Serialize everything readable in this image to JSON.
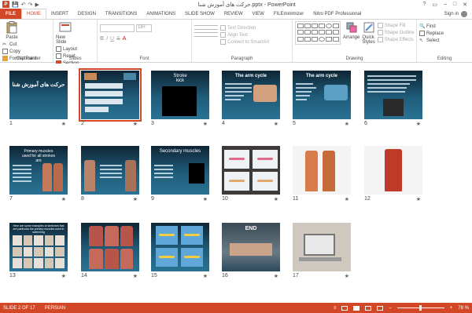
{
  "window": {
    "title": "حرکت های آموزش شنا.pptx - PowerPoint",
    "controls": [
      "?",
      "▭",
      "–",
      "□",
      "✕"
    ]
  },
  "qat": {
    "app_icon": "P",
    "save": "💾",
    "undo": "↶",
    "redo": "↷",
    "start": "▶"
  },
  "tabs": [
    "FILE",
    "HOME",
    "INSERT",
    "DESIGN",
    "TRANSITIONS",
    "ANIMATIONS",
    "SLIDE SHOW",
    "REVIEW",
    "VIEW",
    "FILEminimizer",
    "Nitro PDF Professional"
  ],
  "active_tab": "HOME",
  "signin": "Sign in",
  "ribbon": {
    "clipboard": {
      "paste": "Paste",
      "cut": "Cut",
      "copy": "Copy",
      "format_painter": "Format Painter",
      "label": "Clipboard"
    },
    "slides": {
      "new_slide": "New Slide",
      "layout": "Layout",
      "reset": "Reset",
      "section": "Section",
      "label": "Slides"
    },
    "font": {
      "label": "Font",
      "size": "18+"
    },
    "paragraph": {
      "text_direction": "Text Direction",
      "align_text": "Align Text",
      "convert_smartart": "Convert to SmartArt",
      "label": "Paragraph"
    },
    "drawing": {
      "arrange": "Arrange",
      "quick_styles": "Quick Styles",
      "shape_fill": "Shape Fill",
      "shape_outline": "Shape Outline",
      "shape_effects": "Shape Effects",
      "label": "Drawing"
    },
    "editing": {
      "find": "Find",
      "replace": "Replace",
      "select": "Select",
      "label": "Editing"
    }
  },
  "slides": [
    {
      "num": "1",
      "title": "حرکت های آموزش شنا"
    },
    {
      "num": "2",
      "title": ""
    },
    {
      "num": "3",
      "title": "Stroke kick"
    },
    {
      "num": "4",
      "title": "The arm cycle"
    },
    {
      "num": "5",
      "title": "The arm cycle"
    },
    {
      "num": "6",
      "title": ""
    },
    {
      "num": "7",
      "title": "Primary muscles used for all strokes are"
    },
    {
      "num": "8",
      "title": ""
    },
    {
      "num": "9",
      "title": "Secondary muscles"
    },
    {
      "num": "10",
      "title": ""
    },
    {
      "num": "11",
      "title": ""
    },
    {
      "num": "12",
      "title": ""
    },
    {
      "num": "13",
      "title": "Here are some examples of stretches that are particular the primary muscles used in swimming"
    },
    {
      "num": "14",
      "title": ""
    },
    {
      "num": "15",
      "title": ""
    },
    {
      "num": "16",
      "title": "END"
    },
    {
      "num": "17",
      "title": ""
    }
  ],
  "star": "★",
  "status": {
    "slide_info": "SLIDE 2 OF 17",
    "language": "PERSIAN",
    "notes": "≡",
    "zoom": "78 %"
  },
  "colors": {
    "accent": "#d24726",
    "pool_dark": "#0e2535",
    "pool_light": "#2a7293"
  }
}
